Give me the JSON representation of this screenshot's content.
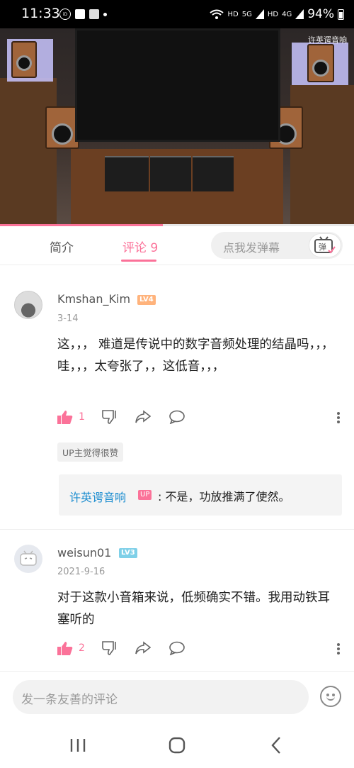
{
  "status_bar": {
    "time": "11:33",
    "net_label_1": "HD",
    "net_label_2": "5G",
    "net_label_3": "HD",
    "net_label_4": "4G",
    "battery": "94%"
  },
  "video": {
    "watermark": "许英谔音响",
    "progress_fraction": 0.46
  },
  "tabs": {
    "intro": "简介",
    "comments": "评论 9",
    "danmaku_placeholder": "点我发弹幕",
    "danmaku_btn": "弹"
  },
  "comments": [
    {
      "username": "Kmshan_Kim",
      "level": "LV4",
      "date": "3-14",
      "text": "这，，， 难道是传说中的数字音频处理的结晶吗，，，哇，，，太夸张了，，这低音，，，",
      "likes": "1",
      "up_tag": "UP主觉得很赞",
      "reply": {
        "name": "许英谔音响",
        "badge": "UP",
        "text": ": 不是，功放推满了使然。"
      }
    },
    {
      "username": "weisun01",
      "level": "LV3",
      "date": "2021-9-16",
      "text": "对于这款小音箱来说，低频确实不错。我用动铁耳塞听的",
      "likes": "2"
    }
  ],
  "input": {
    "placeholder": "发一条友善的评论"
  },
  "colors": {
    "accent": "#fb7299",
    "link": "#178bcf"
  }
}
